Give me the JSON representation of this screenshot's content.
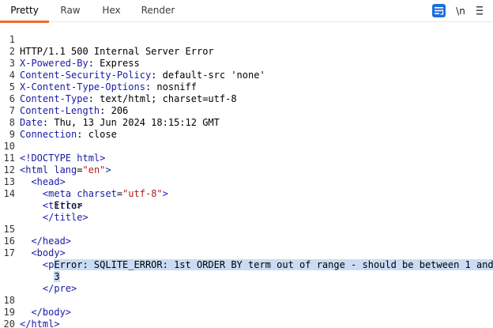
{
  "tabs": [
    "Pretty",
    "Raw",
    "Hex",
    "Render"
  ],
  "active_tab": "Pretty",
  "toolbar": {
    "newline_label": "\\n"
  },
  "line_numbers": [
    "1",
    "2",
    "3",
    "4",
    "5",
    "6",
    "7",
    "8",
    "9",
    "10",
    "11",
    "12",
    "13",
    "14",
    "15",
    "16",
    "17",
    "18",
    "19",
    "20"
  ],
  "response": {
    "status_line": "HTTP/1.1 500 Internal Server Error",
    "headers": [
      {
        "name": "X-Powered-By",
        "value": "Express"
      },
      {
        "name": "Content-Security-Policy",
        "value": "default-src 'none'"
      },
      {
        "name": "X-Content-Type-Options",
        "value": "nosniff"
      },
      {
        "name": "Content-Type",
        "value": "text/html; charset=utf-8"
      },
      {
        "name": "Content-Length",
        "value": "206"
      },
      {
        "name": "Date",
        "value": "Thu, 13 Jun 2024 18:15:12 GMT"
      },
      {
        "name": "Connection",
        "value": "close"
      }
    ],
    "body": {
      "doctype": "<!DOCTYPE html>",
      "html_open": "<html",
      "lang_attr": "lang",
      "lang_value": "\"en\"",
      "gt": ">",
      "head_open": "<head>",
      "meta_open": "<meta",
      "charset_attr": "charset",
      "charset_value": "\"utf-8\"",
      "title_open": "<title>",
      "title_text": "Error",
      "title_close": "</title>",
      "head_close": "</head>",
      "body_open": "<body>",
      "pre_open": "<pre>",
      "error_line1": "Error: SQLITE_ERROR: 1st ORDER BY term out of range - should be between 1 and",
      "error_line2": "3",
      "pre_close": "</pre>",
      "body_close": "</body>",
      "html_close": "</html>"
    }
  },
  "colors": {
    "tab_underline": "#f06a2a",
    "wrap_button": "#1e6fd9",
    "selection": "#c9dcf3",
    "header_name": "#1a1aa6",
    "attr_value": "#b31b1b"
  }
}
